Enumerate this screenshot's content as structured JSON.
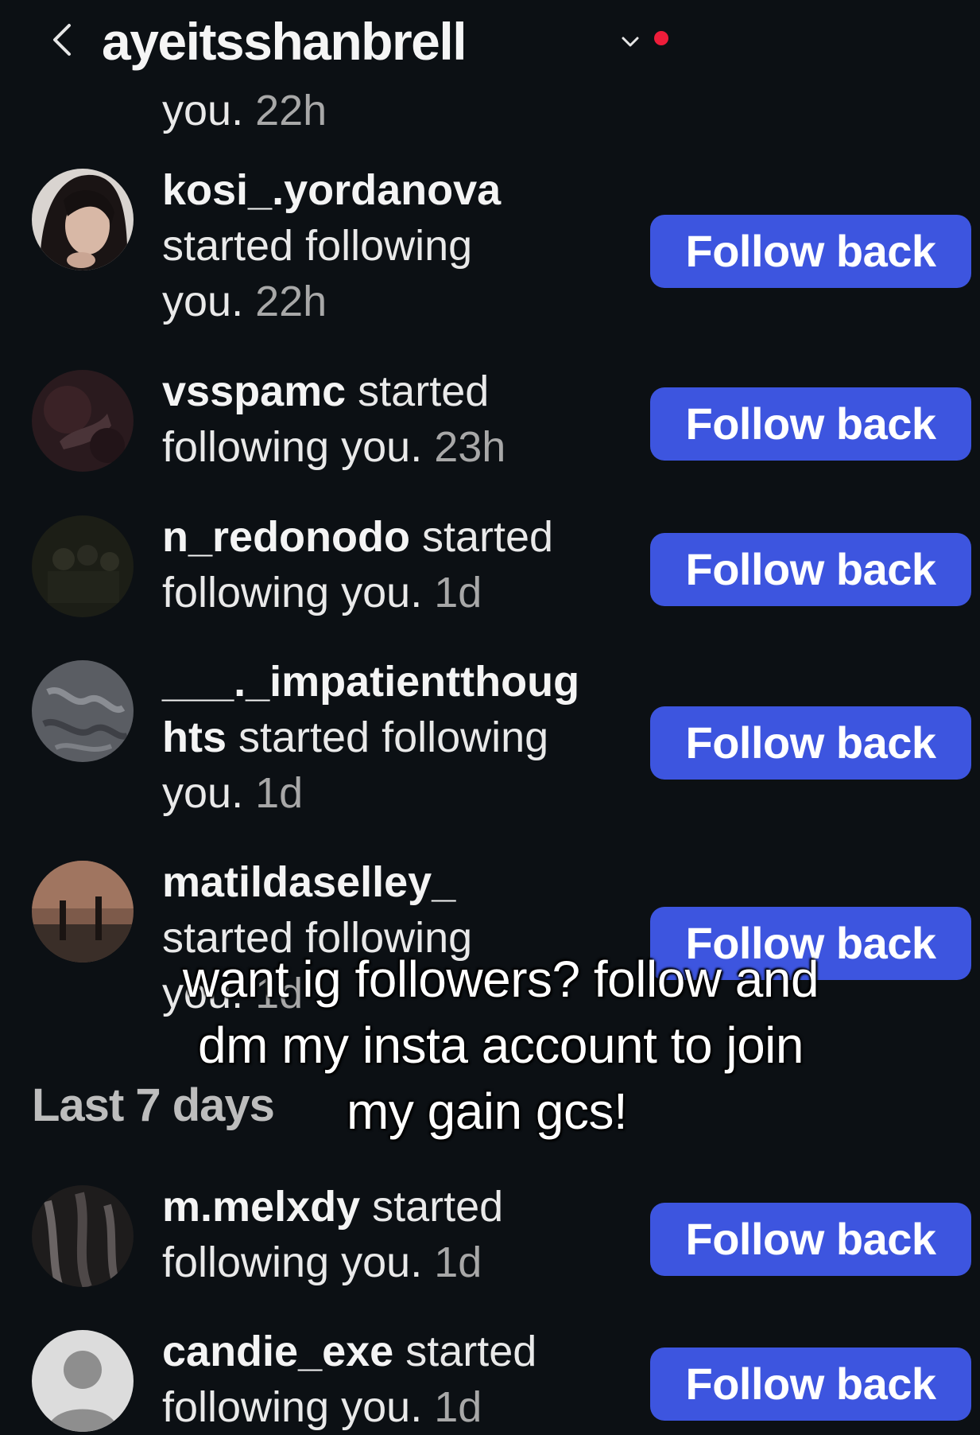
{
  "header": {
    "back_label": "back",
    "title": "ayeitsshanbrell"
  },
  "top_partial": {
    "text": "you.",
    "time": "22h"
  },
  "follow_button_label": "Follow back",
  "notifications": [
    {
      "username": "kosi_.yordanova",
      "line_a": "started following",
      "line_b": "you.",
      "time": "22h"
    },
    {
      "username": "vsspamc",
      "action_a": " started",
      "line_b": "following you.",
      "time": "23h"
    },
    {
      "username": "n_redonodo",
      "action_a": " started",
      "line_b": "following you.",
      "time": "1d"
    },
    {
      "username_a": "___._impatientthoug",
      "username_b": "hts",
      "action_b": " started following",
      "line_c": "you.",
      "time": "1d"
    },
    {
      "username": "matildaselley_",
      "line_a": "started following",
      "line_b": "you.",
      "time": "1d"
    }
  ],
  "section_heading": "Last 7 days",
  "notifications_week": [
    {
      "username": "m.melxdy",
      "action_a": " started",
      "line_b": "following you.",
      "time": "1d"
    },
    {
      "username": "candie_exe",
      "action_a": " started",
      "line_b": "following you.",
      "time": "1d"
    }
  ],
  "caption": {
    "line1": "want ig followers? follow and",
    "line2": "dm my insta account to join",
    "line3": "my gain gcs!"
  },
  "colors": {
    "background": "#0c1014",
    "button": "#3d55df",
    "dot": "#ee1d3a"
  }
}
